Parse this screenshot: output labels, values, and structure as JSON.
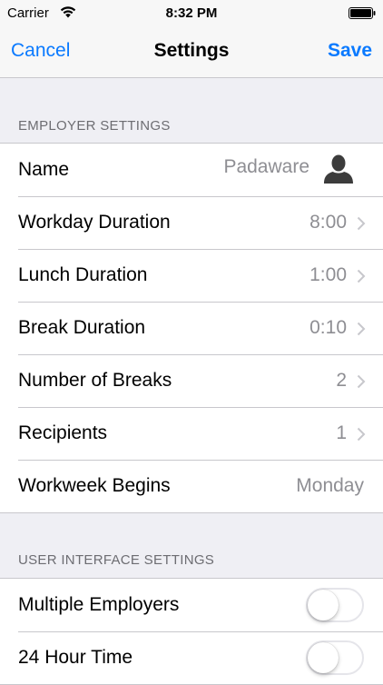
{
  "status_bar": {
    "carrier": "Carrier",
    "time": "8:32 PM"
  },
  "nav": {
    "cancel_label": "Cancel",
    "title": "Settings",
    "save_label": "Save"
  },
  "employer_section": {
    "header": "EMPLOYER SETTINGS",
    "rows": [
      {
        "label": "Name",
        "value": "Padaware",
        "icon": "person-icon"
      },
      {
        "label": "Workday Duration",
        "value": "8:00",
        "icon": "chevron-right-icon"
      },
      {
        "label": "Lunch Duration",
        "value": "1:00",
        "icon": "chevron-right-icon"
      },
      {
        "label": "Break Duration",
        "value": "0:10",
        "icon": "chevron-right-icon"
      },
      {
        "label": "Number of Breaks",
        "value": "2",
        "icon": "chevron-right-icon"
      },
      {
        "label": "Recipients",
        "value": "1",
        "icon": "chevron-right-icon"
      },
      {
        "label": "Workweek Begins",
        "value": "Monday"
      }
    ]
  },
  "ui_section": {
    "header": "USER INTERFACE SETTINGS",
    "rows": [
      {
        "label": "Multiple Employers",
        "toggle_on": false
      },
      {
        "label": "24 Hour Time",
        "toggle_on": false
      }
    ]
  },
  "colors": {
    "accent": "#0a7aff",
    "background": "#efeff4",
    "secondary_text": "#8e8e93",
    "separator": "#c8c7cc"
  }
}
